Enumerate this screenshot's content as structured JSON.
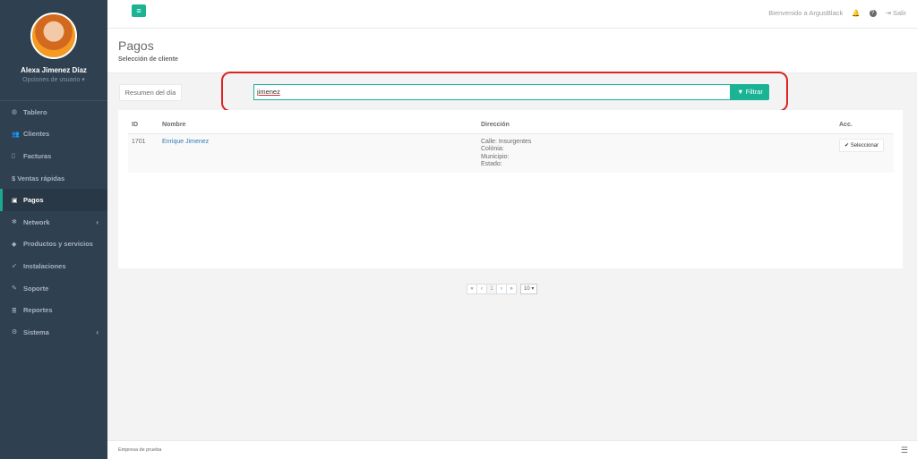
{
  "sidebar": {
    "profile_name": "Alexa Jimenez Díaz",
    "profile_options": "Opciones de usuario ▾",
    "items": [
      {
        "label": "Tablero",
        "icon": "dashboard-icon"
      },
      {
        "label": "Clientes",
        "icon": "users-icon"
      },
      {
        "label": "Facturas",
        "icon": "file-icon"
      },
      {
        "label": "$ Ventas rápidas",
        "icon": ""
      },
      {
        "label": "Pagos",
        "icon": "money-icon"
      },
      {
        "label": "Network",
        "icon": "network-icon"
      },
      {
        "label": "Productos y servicios",
        "icon": "tag-icon"
      },
      {
        "label": "Instalaciones",
        "icon": "rocket-icon"
      },
      {
        "label": "Soporte",
        "icon": "wrench-icon"
      },
      {
        "label": "Reportes",
        "icon": "database-icon"
      },
      {
        "label": "Sistema",
        "icon": "gears-icon"
      }
    ]
  },
  "topbar": {
    "welcome": "Bienvenido a ArgusBlack",
    "logout": "Salir"
  },
  "heading": {
    "title": "Pagos",
    "subtitle": "Selección de cliente"
  },
  "toolbar": {
    "resumen_label": "Resumen del día",
    "search_value": "jimenez",
    "filter_label": "Filtrar"
  },
  "table": {
    "headers": [
      "ID",
      "Nombre",
      "Dirección",
      "Acc."
    ],
    "rows": [
      {
        "id": "1701",
        "name": "Enrique Jimenez",
        "address": [
          "Calle: Insurgentes",
          "Colónia:",
          "Municipio:",
          "Estado:"
        ],
        "action": "Seleccionar"
      }
    ]
  },
  "pagination": {
    "first": "«",
    "prev": "‹",
    "current": "1",
    "next": "›",
    "last": "»",
    "page_size": "10"
  },
  "footer": {
    "text": "Empresa de prueba"
  },
  "colors": {
    "accent": "#1ab394",
    "sidebar": "#2f4050",
    "highlight": "#dd2323"
  }
}
